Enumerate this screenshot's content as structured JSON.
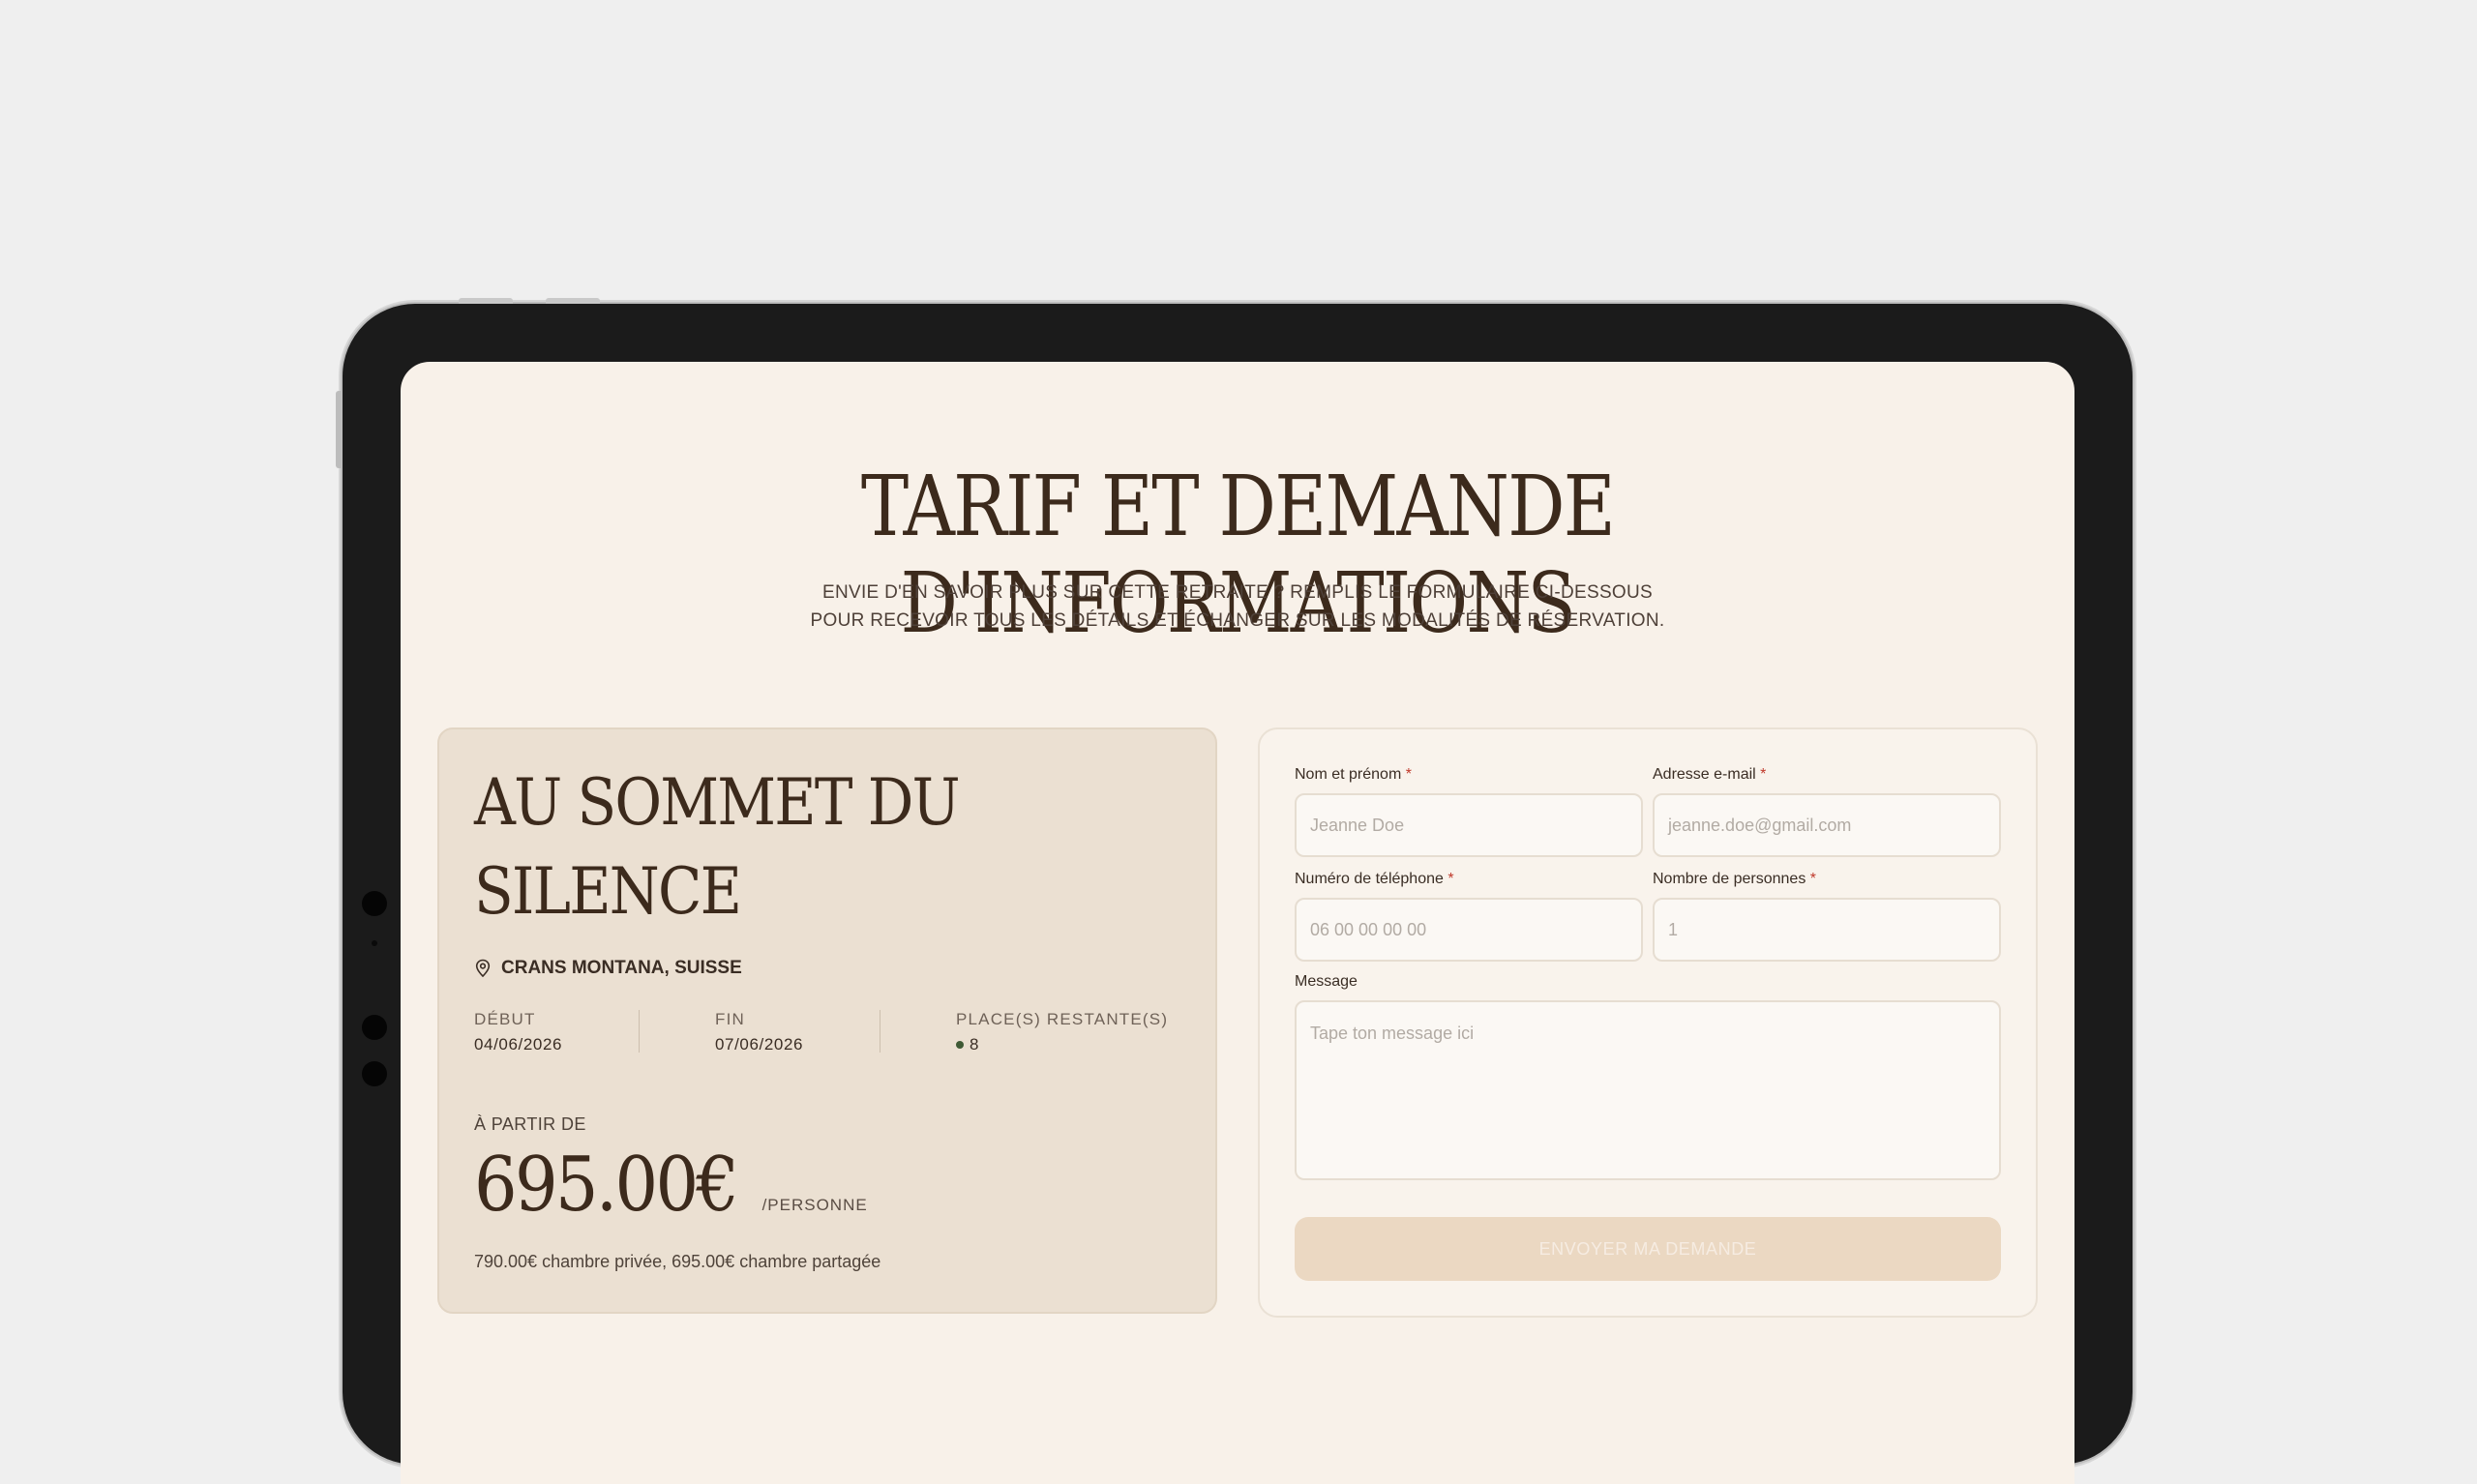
{
  "page": {
    "title": "TARIF ET DEMANDE D'INFORMATIONS",
    "subtitle_line1": "ENVIE D'EN SAVOIR PLUS SUR CETTE RETRAITE ? REMPLIS LE FORMULAIRE CI-DESSOUS",
    "subtitle_line2": "POUR RECEVOIR TOUS LES DÉTAILS ET ÉCHANGER SUR LES MODALITÉS DE RÉSERVATION."
  },
  "retreat": {
    "title_line1": "AU SOMMET DU",
    "title_line2": "SILENCE",
    "location": "CRANS MONTANA, SUISSE",
    "start_label": "DÉBUT",
    "start_date": "04/06/2026",
    "end_label": "FIN",
    "end_date": "07/06/2026",
    "places_label": "PLACE(S) RESTANTE(S)",
    "places_value": "8",
    "from_label": "À PARTIR DE",
    "price": "695.00€",
    "per_person": "/PERSONNE",
    "price_detail": "790.00€ chambre privée, 695.00€ chambre partagée",
    "status_color": "#3f5a35"
  },
  "form": {
    "name_label": "Nom et prénom",
    "name_placeholder": "Jeanne Doe",
    "email_label": "Adresse e-mail",
    "email_placeholder": "jeanne.doe@gmail.com",
    "phone_label": "Numéro de  téléphone",
    "phone_placeholder": "06 00 00 00 00",
    "people_label": "Nombre de personnes",
    "people_placeholder": "1",
    "message_label": "Message",
    "message_placeholder": "Tape ton message ici",
    "required_mark": "*",
    "submit_label": "ENVOYER MA DEMANDE"
  },
  "colors": {
    "background": "#efefef",
    "screen": "#f8f1e9",
    "card": "#ebe0d2",
    "accent_button": "#ebd8c2",
    "title_brown": "#3c2a1c"
  }
}
